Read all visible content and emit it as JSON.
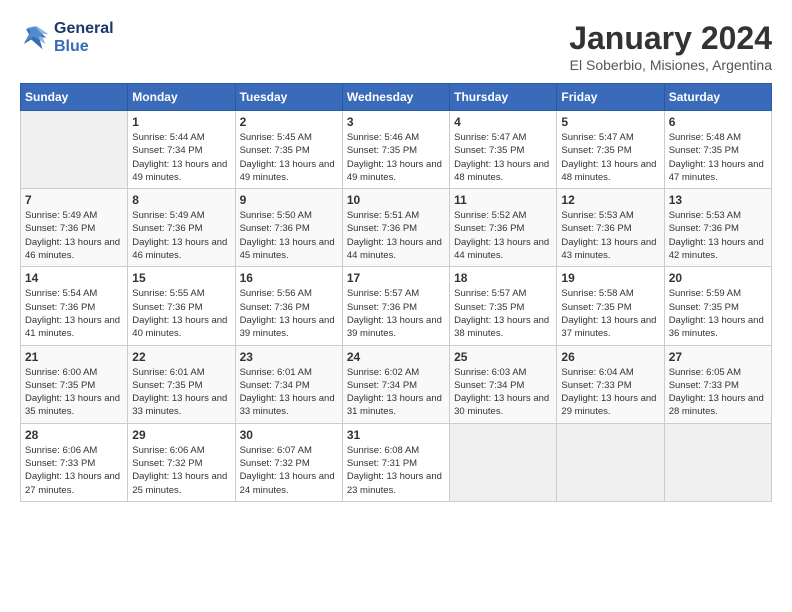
{
  "header": {
    "logo_line1": "General",
    "logo_line2": "Blue",
    "month_title": "January 2024",
    "subtitle": "El Soberbio, Misiones, Argentina"
  },
  "days_of_week": [
    "Sunday",
    "Monday",
    "Tuesday",
    "Wednesday",
    "Thursday",
    "Friday",
    "Saturday"
  ],
  "weeks": [
    [
      {
        "day": "",
        "sunrise": "",
        "sunset": "",
        "daylight": ""
      },
      {
        "day": "1",
        "sunrise": "Sunrise: 5:44 AM",
        "sunset": "Sunset: 7:34 PM",
        "daylight": "Daylight: 13 hours and 49 minutes."
      },
      {
        "day": "2",
        "sunrise": "Sunrise: 5:45 AM",
        "sunset": "Sunset: 7:35 PM",
        "daylight": "Daylight: 13 hours and 49 minutes."
      },
      {
        "day": "3",
        "sunrise": "Sunrise: 5:46 AM",
        "sunset": "Sunset: 7:35 PM",
        "daylight": "Daylight: 13 hours and 49 minutes."
      },
      {
        "day": "4",
        "sunrise": "Sunrise: 5:47 AM",
        "sunset": "Sunset: 7:35 PM",
        "daylight": "Daylight: 13 hours and 48 minutes."
      },
      {
        "day": "5",
        "sunrise": "Sunrise: 5:47 AM",
        "sunset": "Sunset: 7:35 PM",
        "daylight": "Daylight: 13 hours and 48 minutes."
      },
      {
        "day": "6",
        "sunrise": "Sunrise: 5:48 AM",
        "sunset": "Sunset: 7:35 PM",
        "daylight": "Daylight: 13 hours and 47 minutes."
      }
    ],
    [
      {
        "day": "7",
        "sunrise": "Sunrise: 5:49 AM",
        "sunset": "Sunset: 7:36 PM",
        "daylight": "Daylight: 13 hours and 46 minutes."
      },
      {
        "day": "8",
        "sunrise": "Sunrise: 5:49 AM",
        "sunset": "Sunset: 7:36 PM",
        "daylight": "Daylight: 13 hours and 46 minutes."
      },
      {
        "day": "9",
        "sunrise": "Sunrise: 5:50 AM",
        "sunset": "Sunset: 7:36 PM",
        "daylight": "Daylight: 13 hours and 45 minutes."
      },
      {
        "day": "10",
        "sunrise": "Sunrise: 5:51 AM",
        "sunset": "Sunset: 7:36 PM",
        "daylight": "Daylight: 13 hours and 44 minutes."
      },
      {
        "day": "11",
        "sunrise": "Sunrise: 5:52 AM",
        "sunset": "Sunset: 7:36 PM",
        "daylight": "Daylight: 13 hours and 44 minutes."
      },
      {
        "day": "12",
        "sunrise": "Sunrise: 5:53 AM",
        "sunset": "Sunset: 7:36 PM",
        "daylight": "Daylight: 13 hours and 43 minutes."
      },
      {
        "day": "13",
        "sunrise": "Sunrise: 5:53 AM",
        "sunset": "Sunset: 7:36 PM",
        "daylight": "Daylight: 13 hours and 42 minutes."
      }
    ],
    [
      {
        "day": "14",
        "sunrise": "Sunrise: 5:54 AM",
        "sunset": "Sunset: 7:36 PM",
        "daylight": "Daylight: 13 hours and 41 minutes."
      },
      {
        "day": "15",
        "sunrise": "Sunrise: 5:55 AM",
        "sunset": "Sunset: 7:36 PM",
        "daylight": "Daylight: 13 hours and 40 minutes."
      },
      {
        "day": "16",
        "sunrise": "Sunrise: 5:56 AM",
        "sunset": "Sunset: 7:36 PM",
        "daylight": "Daylight: 13 hours and 39 minutes."
      },
      {
        "day": "17",
        "sunrise": "Sunrise: 5:57 AM",
        "sunset": "Sunset: 7:36 PM",
        "daylight": "Daylight: 13 hours and 39 minutes."
      },
      {
        "day": "18",
        "sunrise": "Sunrise: 5:57 AM",
        "sunset": "Sunset: 7:35 PM",
        "daylight": "Daylight: 13 hours and 38 minutes."
      },
      {
        "day": "19",
        "sunrise": "Sunrise: 5:58 AM",
        "sunset": "Sunset: 7:35 PM",
        "daylight": "Daylight: 13 hours and 37 minutes."
      },
      {
        "day": "20",
        "sunrise": "Sunrise: 5:59 AM",
        "sunset": "Sunset: 7:35 PM",
        "daylight": "Daylight: 13 hours and 36 minutes."
      }
    ],
    [
      {
        "day": "21",
        "sunrise": "Sunrise: 6:00 AM",
        "sunset": "Sunset: 7:35 PM",
        "daylight": "Daylight: 13 hours and 35 minutes."
      },
      {
        "day": "22",
        "sunrise": "Sunrise: 6:01 AM",
        "sunset": "Sunset: 7:35 PM",
        "daylight": "Daylight: 13 hours and 33 minutes."
      },
      {
        "day": "23",
        "sunrise": "Sunrise: 6:01 AM",
        "sunset": "Sunset: 7:34 PM",
        "daylight": "Daylight: 13 hours and 33 minutes."
      },
      {
        "day": "24",
        "sunrise": "Sunrise: 6:02 AM",
        "sunset": "Sunset: 7:34 PM",
        "daylight": "Daylight: 13 hours and 31 minutes."
      },
      {
        "day": "25",
        "sunrise": "Sunrise: 6:03 AM",
        "sunset": "Sunset: 7:34 PM",
        "daylight": "Daylight: 13 hours and 30 minutes."
      },
      {
        "day": "26",
        "sunrise": "Sunrise: 6:04 AM",
        "sunset": "Sunset: 7:33 PM",
        "daylight": "Daylight: 13 hours and 29 minutes."
      },
      {
        "day": "27",
        "sunrise": "Sunrise: 6:05 AM",
        "sunset": "Sunset: 7:33 PM",
        "daylight": "Daylight: 13 hours and 28 minutes."
      }
    ],
    [
      {
        "day": "28",
        "sunrise": "Sunrise: 6:06 AM",
        "sunset": "Sunset: 7:33 PM",
        "daylight": "Daylight: 13 hours and 27 minutes."
      },
      {
        "day": "29",
        "sunrise": "Sunrise: 6:06 AM",
        "sunset": "Sunset: 7:32 PM",
        "daylight": "Daylight: 13 hours and 25 minutes."
      },
      {
        "day": "30",
        "sunrise": "Sunrise: 6:07 AM",
        "sunset": "Sunset: 7:32 PM",
        "daylight": "Daylight: 13 hours and 24 minutes."
      },
      {
        "day": "31",
        "sunrise": "Sunrise: 6:08 AM",
        "sunset": "Sunset: 7:31 PM",
        "daylight": "Daylight: 13 hours and 23 minutes."
      },
      {
        "day": "",
        "sunrise": "",
        "sunset": "",
        "daylight": ""
      },
      {
        "day": "",
        "sunrise": "",
        "sunset": "",
        "daylight": ""
      },
      {
        "day": "",
        "sunrise": "",
        "sunset": "",
        "daylight": ""
      }
    ]
  ]
}
